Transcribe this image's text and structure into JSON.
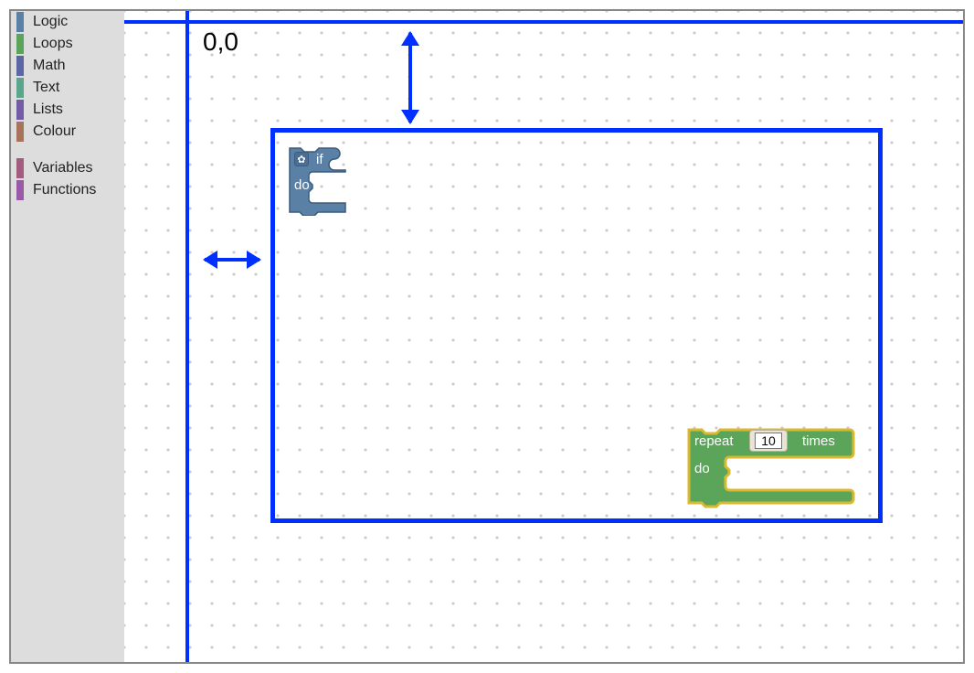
{
  "origin_label": "0,0",
  "toolbox": {
    "groups": [
      [
        {
          "label": "Logic",
          "color": "#5b80a5"
        },
        {
          "label": "Loops",
          "color": "#5ba55b"
        },
        {
          "label": "Math",
          "color": "#5b67a5"
        },
        {
          "label": "Text",
          "color": "#5ba58c"
        },
        {
          "label": "Lists",
          "color": "#745ba5"
        },
        {
          "label": "Colour",
          "color": "#a5745b"
        }
      ],
      [
        {
          "label": "Variables",
          "color": "#a55b80"
        },
        {
          "label": "Functions",
          "color": "#995ba5"
        }
      ]
    ]
  },
  "blocks": {
    "if": {
      "gear_glyph": "✿",
      "label_if": "if",
      "label_do": "do",
      "fill": "#5b80a5",
      "stroke": "#3b5c7a"
    },
    "repeat": {
      "label_repeat": "repeat",
      "label_times": "times",
      "label_do": "do",
      "count_value": "10",
      "fill": "#5ba55b",
      "stroke": "#d8b92f"
    }
  },
  "annotation": {
    "axis_color": "#0030ff"
  }
}
